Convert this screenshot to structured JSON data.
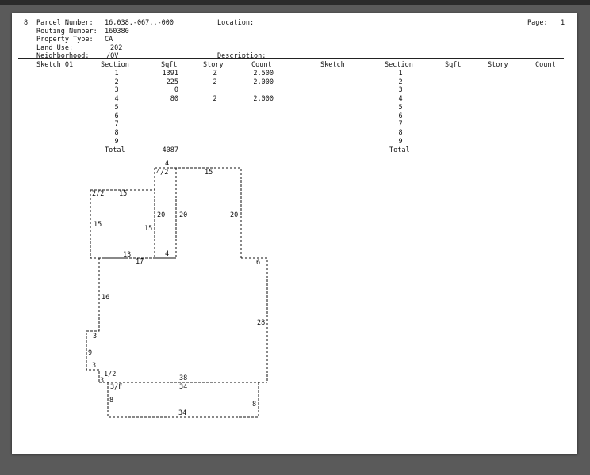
{
  "header": {
    "record_no": "8",
    "parcel_label": "Parcel Number:",
    "parcel_value": "16,038.-067..-000",
    "location_label": "Location:",
    "page_label": "Page:",
    "page_value": "1",
    "routing_label": "Routing Number:",
    "routing_value": "160380",
    "property_type_label": "Property Type:",
    "property_type_value": "CA",
    "land_use_label": "Land Use:",
    "land_use_value": "202",
    "neighborhood_label": "Neighborhood:",
    "neighborhood_value": "/OV",
    "description_label": "Description:"
  },
  "left_table": {
    "sketch_name": "Sketch 01",
    "columns": [
      "Section",
      "Sqft",
      "Story",
      "Count"
    ],
    "rows": [
      {
        "section": "1",
        "sqft": "1391",
        "story": "Z",
        "count": "2.500"
      },
      {
        "section": "2",
        "sqft": "225",
        "story": "2",
        "count": "2.000"
      },
      {
        "section": "3",
        "sqft": "0",
        "story": "",
        "count": ""
      },
      {
        "section": "4",
        "sqft": "80",
        "story": "2",
        "count": "2.000"
      },
      {
        "section": "5",
        "sqft": "",
        "story": "",
        "count": ""
      },
      {
        "section": "6",
        "sqft": "",
        "story": "",
        "count": ""
      },
      {
        "section": "7",
        "sqft": "",
        "story": "",
        "count": ""
      },
      {
        "section": "8",
        "sqft": "",
        "story": "",
        "count": ""
      },
      {
        "section": "9",
        "sqft": "",
        "story": "",
        "count": ""
      }
    ],
    "total_label": "Total",
    "total_sqft": "4087"
  },
  "right_table": {
    "sketch_col": "Sketch",
    "columns": [
      "Section",
      "Sqft",
      "Story",
      "Count"
    ],
    "rows": [
      "1",
      "2",
      "3",
      "4",
      "5",
      "6",
      "7",
      "8",
      "9"
    ],
    "total_label": "Total"
  },
  "sketch": {
    "labels": [
      "4",
      "4/2",
      "15",
      "2/2",
      "15",
      "20",
      "20",
      "20",
      "15",
      "15",
      "13",
      "17",
      "4",
      "6",
      "16",
      "28",
      "3",
      "9",
      "3",
      "1/2",
      "3",
      "38",
      "3/F",
      "34",
      "8",
      "8",
      "34"
    ]
  }
}
